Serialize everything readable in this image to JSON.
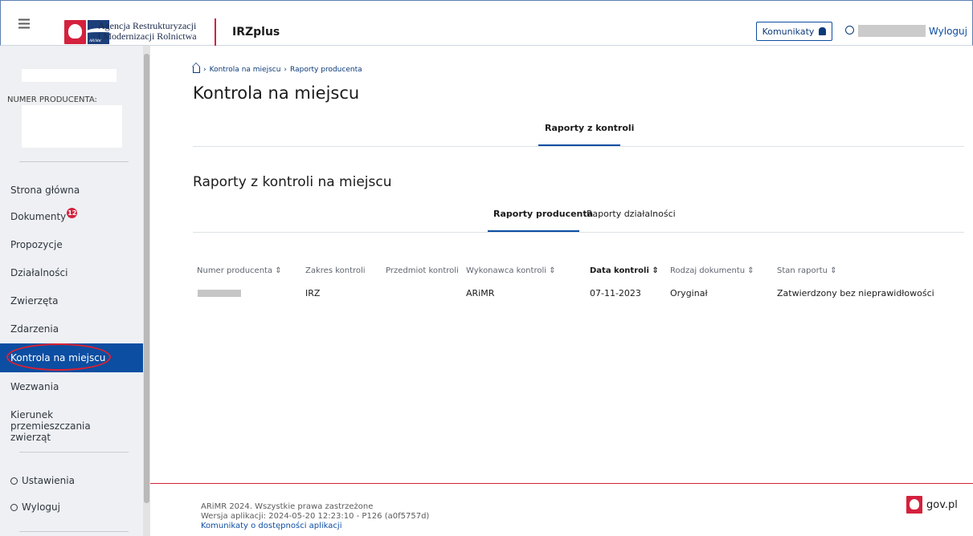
{
  "header": {
    "logo_text_line1": "Agencja Restrukturyzacji",
    "logo_text_line2": "i Modernizacji Rolnictwa",
    "logo_abbr": "ARiMR",
    "app_name": "IRZplus",
    "komunikaty_label": "Komunikaty",
    "logout_label": "Wyloguj"
  },
  "sidebar": {
    "producer_label": "NUMER PRODUCENTA:",
    "items": [
      {
        "label": "Strona główna"
      },
      {
        "label": "Dokumenty",
        "badge": "12"
      },
      {
        "label": "Propozycje"
      },
      {
        "label": "Działalności"
      },
      {
        "label": "Zwierzęta"
      },
      {
        "label": "Zdarzenia"
      },
      {
        "label": "Kontrola na miejscu"
      },
      {
        "label": "Wezwania"
      },
      {
        "label": "Kierunek przemieszczania zwierząt"
      }
    ],
    "bottom": [
      {
        "label": "Ustawienia",
        "icon": "gear-icon"
      },
      {
        "label": "Wyloguj",
        "icon": "user-icon"
      }
    ]
  },
  "breadcrumb": {
    "items": [
      "Kontrola na miejscu",
      "Raporty producenta"
    ]
  },
  "main": {
    "title": "Kontrola na miejscu",
    "top_tab": "Raporty z kontroli",
    "section_title": "Raporty z kontroli na miejscu",
    "sub_tabs": [
      "Raporty producenta",
      "Raporty działalności"
    ],
    "active_sub_tab": "Raporty producenta"
  },
  "table": {
    "columns": [
      "Numer producenta",
      "Zakres kontroli",
      "Przedmiot kontroli",
      "Wykonawca kontroli",
      "Data kontroli",
      "Rodzaj dokumentu",
      "Stan raportu"
    ],
    "sortable": [
      true,
      false,
      false,
      true,
      true,
      true,
      true
    ],
    "active_sort_column": "Data kontroli",
    "rows": [
      {
        "zakres": "IRZ",
        "przedmiot": "",
        "wykonawca": "ARiMR",
        "data": "07-11-2023",
        "rodzaj": "Oryginał",
        "stan": "Zatwierdzony bez nieprawidłowości"
      }
    ]
  },
  "footer": {
    "copyright": "ARiMR 2024. Wszystkie prawa zastrzeżone",
    "version": "Wersja aplikacji: 2024-05-20 12:23:10 - P126 (a0f5757d)",
    "accessibility_link": "Komunikaty o dostępności aplikacji",
    "govpl": "gov.pl"
  },
  "colors": {
    "primary": "#0c4ea2",
    "accent_red": "#d4213d",
    "sidebar_bg": "#eef0f3"
  }
}
